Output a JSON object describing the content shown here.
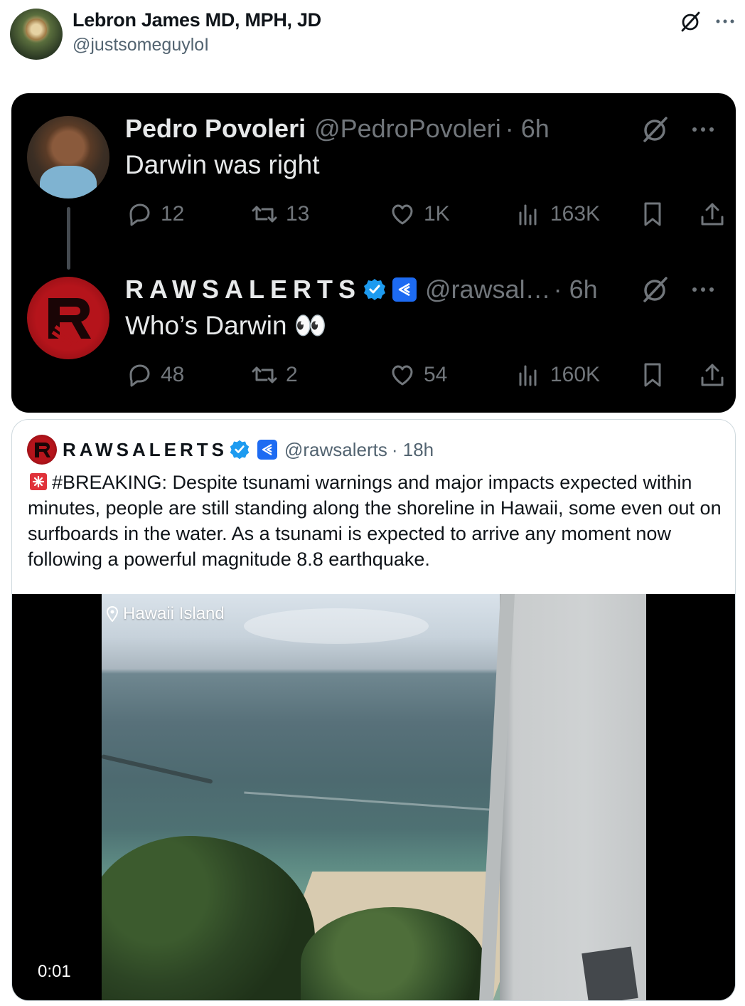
{
  "post": {
    "author_name": "Lebron James MD, MPH, JD",
    "author_handle": "@justsomeguyloI",
    "icons": [
      "grok-icon",
      "more-icon"
    ]
  },
  "screenshot": {
    "tweets": [
      {
        "name": "Pedro Povoleri",
        "handle": "@PedroPovoleri",
        "time": "· 6h",
        "text": "Darwin was right",
        "replies": "12",
        "retweets": "13",
        "likes": "1K",
        "views": "163K"
      },
      {
        "name": "RAWSALERTS",
        "handle": "@rawsal…",
        "time": "· 6h",
        "text": "Who’s Darwin 👀",
        "replies": "48",
        "retweets": "2",
        "likes": "54",
        "views": "160K"
      }
    ]
  },
  "quote": {
    "name": "RAWSALERTS",
    "handle": "@rawsalerts",
    "time": "· 18h",
    "text": "#BREAKING: Despite tsunami warnings and major impacts expected within minutes, people are still standing along the shoreline in Hawaii, some even out on surfboards in the water. As a tsunami is expected to arrive any moment now following a powerful magnitude 8.8 earthquake.",
    "video": {
      "location": "Hawaii Island",
      "duration": "0:01"
    }
  },
  "colors": {
    "verified_blue": "#1d9bf0",
    "affiliate_blue": "#1d6bf2",
    "dark_bg": "#000000",
    "muted_text": "#71767b",
    "brand_red": "#b5141b"
  }
}
